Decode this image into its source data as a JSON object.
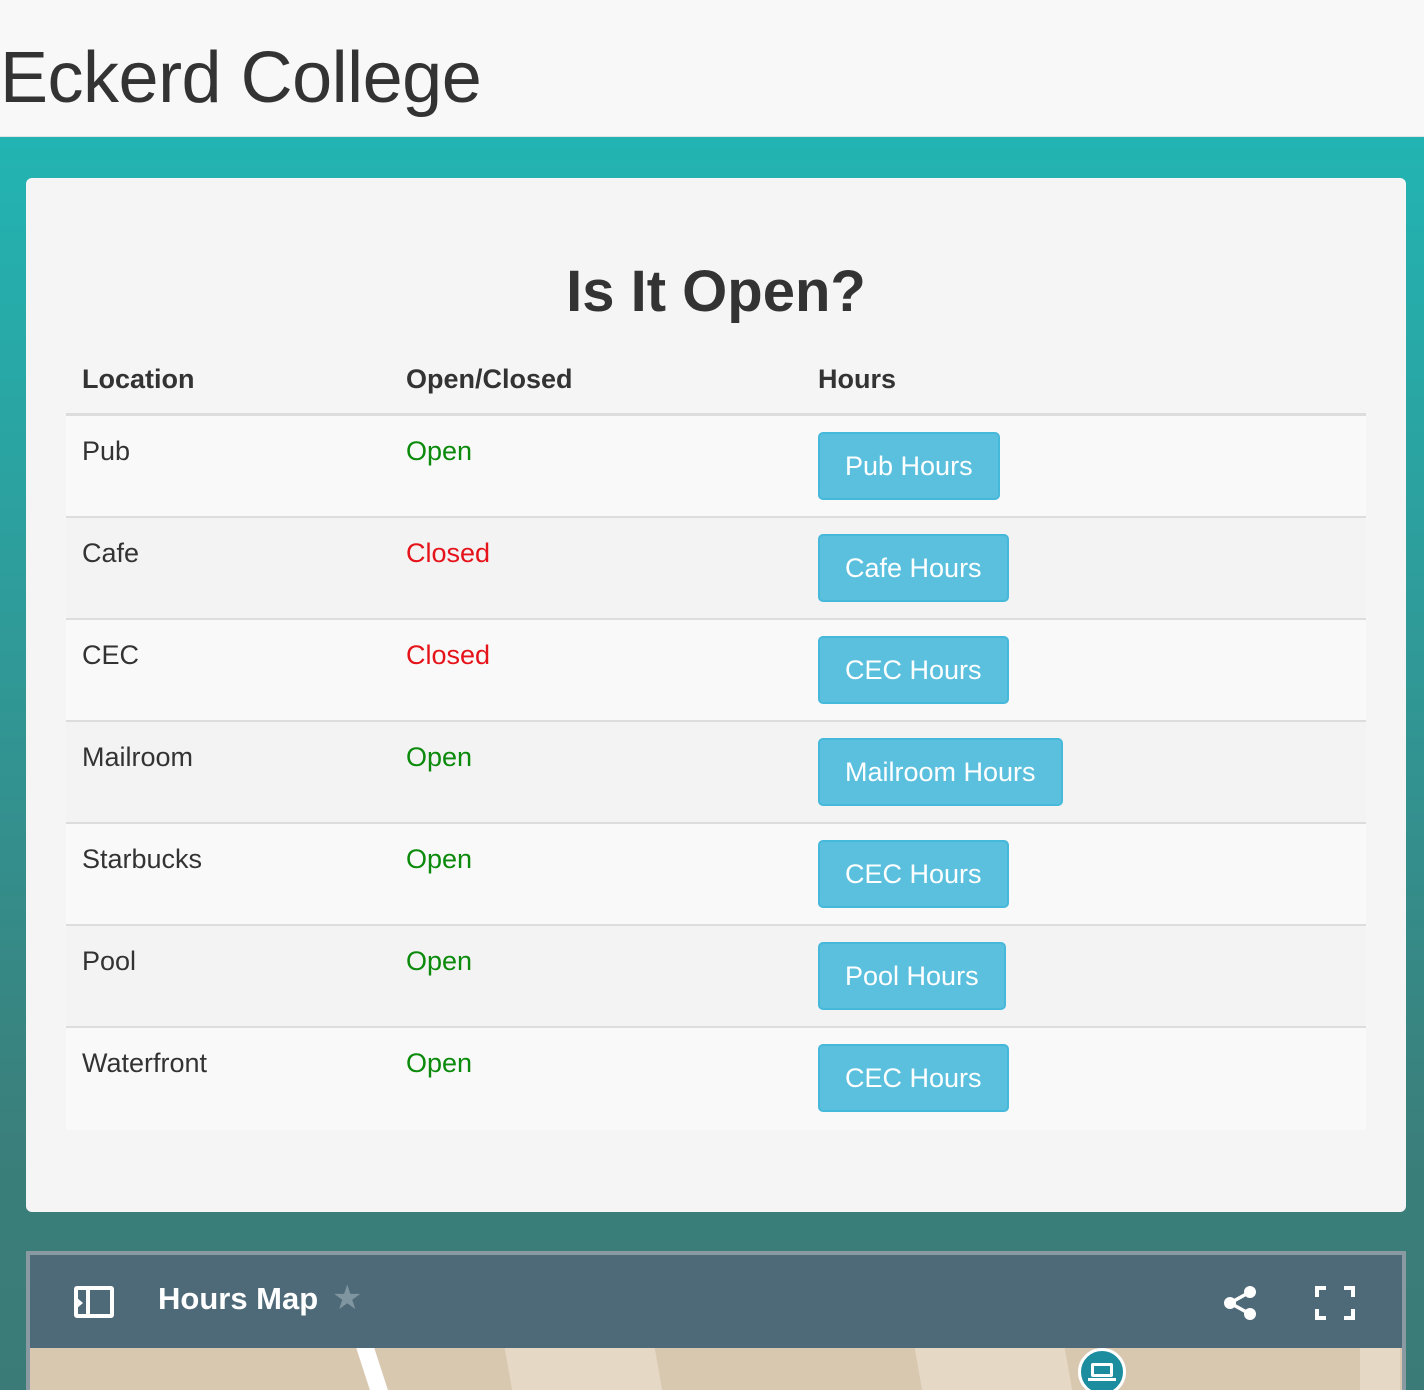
{
  "header": {
    "title": "Eckerd College"
  },
  "main": {
    "title": "Is It Open?",
    "columns": [
      "Location",
      "Open/Closed",
      "Hours"
    ],
    "rows": [
      {
        "location": "Pub",
        "status": "Open",
        "hours_button": "Pub Hours"
      },
      {
        "location": "Cafe",
        "status": "Closed",
        "hours_button": "Cafe Hours"
      },
      {
        "location": "CEC",
        "status": "Closed",
        "hours_button": "CEC Hours"
      },
      {
        "location": "Mailroom",
        "status": "Open",
        "hours_button": "Mailroom Hours"
      },
      {
        "location": "Starbucks",
        "status": "Open",
        "hours_button": "CEC Hours"
      },
      {
        "location": "Pool",
        "status": "Open",
        "hours_button": "Pool Hours"
      },
      {
        "location": "Waterfront",
        "status": "Open",
        "hours_button": "CEC Hours"
      }
    ]
  },
  "map": {
    "title": "Hours Map",
    "icons": [
      "sidebar-toggle-icon",
      "star-icon",
      "share-icon",
      "fullscreen-icon",
      "laptop-icon"
    ]
  },
  "colors": {
    "open": "#0b8a0b",
    "closed": "#e5131a",
    "button": "#5bc0de",
    "background_top": "#22b4b2",
    "background_bottom": "#3a7b77",
    "map_toolbar": "#4e6a78"
  }
}
